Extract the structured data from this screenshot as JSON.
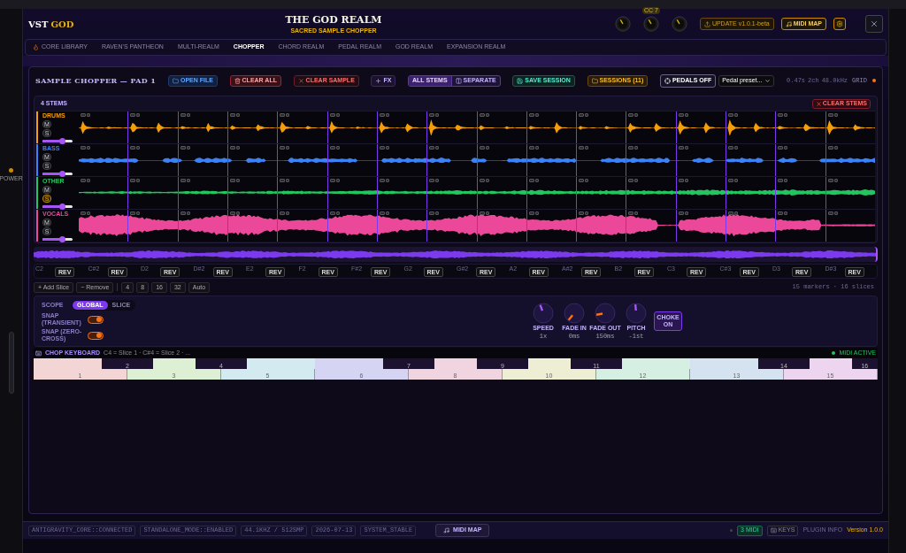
{
  "rail": {
    "power_label": "POWER"
  },
  "header": {
    "logo_first": "VST",
    "logo_second": "GOD",
    "title": "THE GOD REALM",
    "subtitle": "SACRED SAMPLE CHOPPER",
    "cc_badge": "CC 7",
    "update_button": "UPDATE v1.0.1-beta",
    "midi_button": "MIDI MAP"
  },
  "tabs": [
    {
      "label": "CORE LIBRARY",
      "selected": false
    },
    {
      "label": "RAVEN'S PANTHEON",
      "selected": false
    },
    {
      "label": "MULTI-REALM",
      "selected": false
    },
    {
      "label": "CHOPPER",
      "selected": true
    },
    {
      "label": "CHORD REALM",
      "selected": false
    },
    {
      "label": "PEDAL REALM",
      "selected": false
    },
    {
      "label": "GOD REALM",
      "selected": false
    },
    {
      "label": "EXPANSION REALM",
      "selected": false
    }
  ],
  "toolbar": {
    "title": "SAMPLE CHOPPER — PAD 1",
    "buttons": [
      {
        "label": "OPEN FILE",
        "kind": "open"
      },
      {
        "label": "CLEAR ALL",
        "kind": "danger"
      },
      {
        "label": "CLEAR SAMPLE",
        "kind": "clear"
      },
      {
        "label": "FX",
        "kind": "fx"
      }
    ],
    "stem_modes": [
      {
        "label": "ALL STEMS",
        "selected": true
      },
      {
        "label": "SEPARATE",
        "selected": false
      }
    ],
    "session_buttons": [
      {
        "label": "SAVE SESSION",
        "kind": "save"
      },
      {
        "label": "SESSIONS (11)",
        "kind": "sessions"
      }
    ],
    "pedals": {
      "label": "PEDALS OFF",
      "on": false
    },
    "preset_select": {
      "placeholder": "Pedal preset..."
    },
    "info": [
      "0.47s",
      "2ch",
      "48.0kHz"
    ],
    "grid": {
      "label": "GRID",
      "on": true
    }
  },
  "stems": {
    "count_label": "4 STEMS",
    "clear_button": "CLEAR STEMS",
    "lanes": [
      {
        "name": "DRUMS",
        "kind": "drums",
        "color": "#f59e0b",
        "mute_label": "M",
        "solo_label": "S",
        "muted": false,
        "solo": false,
        "level": 0.65
      },
      {
        "name": "BASS",
        "kind": "bass",
        "color": "#3b82f6",
        "mute_label": "M",
        "solo_label": "S",
        "muted": false,
        "solo": false,
        "level": 0.65
      },
      {
        "name": "OTHER",
        "kind": "other",
        "color": "#22c55e",
        "mute_label": "M",
        "solo_label": "S",
        "muted": false,
        "solo": true,
        "level": 0.65
      },
      {
        "name": "VOCALS",
        "kind": "vocals",
        "color": "#ec4899",
        "mute_label": "M",
        "solo_label": "S",
        "muted": false,
        "solo": false,
        "level": 0.65
      }
    ]
  },
  "slices": [
    {
      "note": "C2",
      "button": "REV"
    },
    {
      "note": "C#2",
      "button": "REV"
    },
    {
      "note": "D2",
      "button": "REV"
    },
    {
      "note": "D#2",
      "button": "REV"
    },
    {
      "note": "E2",
      "button": "REV"
    },
    {
      "note": "F2",
      "button": "REV"
    },
    {
      "note": "F#2",
      "button": "REV"
    },
    {
      "note": "G2",
      "button": "REV"
    },
    {
      "note": "G#2",
      "button": "REV"
    },
    {
      "note": "A2",
      "button": "REV"
    },
    {
      "note": "A#2",
      "button": "REV"
    },
    {
      "note": "B2",
      "button": "REV"
    },
    {
      "note": "C3",
      "button": "REV"
    },
    {
      "note": "C#3",
      "button": "REV"
    },
    {
      "note": "D3",
      "button": "REV"
    },
    {
      "note": "D#3",
      "button": "REV"
    }
  ],
  "slice_controls": {
    "buttons": [
      "+ Add Slice",
      "− Remove"
    ],
    "divisions": [
      "4",
      "8",
      "16",
      "32",
      "Auto"
    ],
    "summary": "15 markers · 16 slices"
  },
  "params": {
    "scope_label": "SCOPE",
    "scope_options": [
      {
        "label": "GLOBAL",
        "selected": true
      },
      {
        "label": "SLICE",
        "selected": false
      }
    ],
    "toggles": [
      {
        "label": "SNAP (TRANSIENT)",
        "on": true
      },
      {
        "label": "SNAP (ZERO-CROSS)",
        "on": true
      }
    ],
    "knobs": [
      {
        "label": "SPEED",
        "value": "1x",
        "color": "#a855f7"
      },
      {
        "label": "FADE IN",
        "value": "0ms",
        "color": "#f97316"
      },
      {
        "label": "FADE OUT",
        "value": "150ms",
        "color": "#f97316"
      },
      {
        "label": "PITCH",
        "value": "-1st",
        "color": "#a855f7"
      }
    ],
    "choke": {
      "label": "CHOKE ON",
      "on": true
    }
  },
  "keyboard": {
    "title": "CHOP KEYBOARD",
    "hint": "C4 = Slice 1 · C#4 = Slice 2 · ...",
    "midi_status": "MIDI ACTIVE",
    "keys": [
      {
        "label": "1",
        "kind": "white",
        "color": "#f3d5d5"
      },
      {
        "label": "2",
        "kind": "black"
      },
      {
        "label": "3",
        "kind": "white",
        "color": "#def0d3"
      },
      {
        "label": "4",
        "kind": "black"
      },
      {
        "label": "5",
        "kind": "white",
        "color": "#d3ebf0"
      },
      {
        "label": "6",
        "kind": "white",
        "color": "#d5d5f3"
      },
      {
        "label": "7",
        "kind": "black"
      },
      {
        "label": "8",
        "kind": "white",
        "color": "#f0d5e0"
      },
      {
        "label": "9",
        "kind": "black"
      },
      {
        "label": "10",
        "kind": "white",
        "color": "#eeeed5"
      },
      {
        "label": "11",
        "kind": "black"
      },
      {
        "label": "12",
        "kind": "white",
        "color": "#d5f0e3"
      },
      {
        "label": "13",
        "kind": "white",
        "color": "#d5e3f0"
      },
      {
        "label": "14",
        "kind": "black"
      },
      {
        "label": "15",
        "kind": "white",
        "color": "#edd5f0"
      },
      {
        "label": "16",
        "kind": "black"
      }
    ]
  },
  "status_bar": {
    "items": [
      "ANTIGRAVITY_CORE::CONNECTED",
      "STANDALONE_MODE::ENABLED",
      "44.1KHZ / 512SMP",
      "2026-07-13",
      "SYSTEM_STABLE"
    ],
    "midi_button": "MIDI MAP",
    "midi_count": "3 MIDI",
    "keys_button": "KEYS",
    "plugin_info": "PLUGIN INFO",
    "version": "Version 1.0.0"
  }
}
